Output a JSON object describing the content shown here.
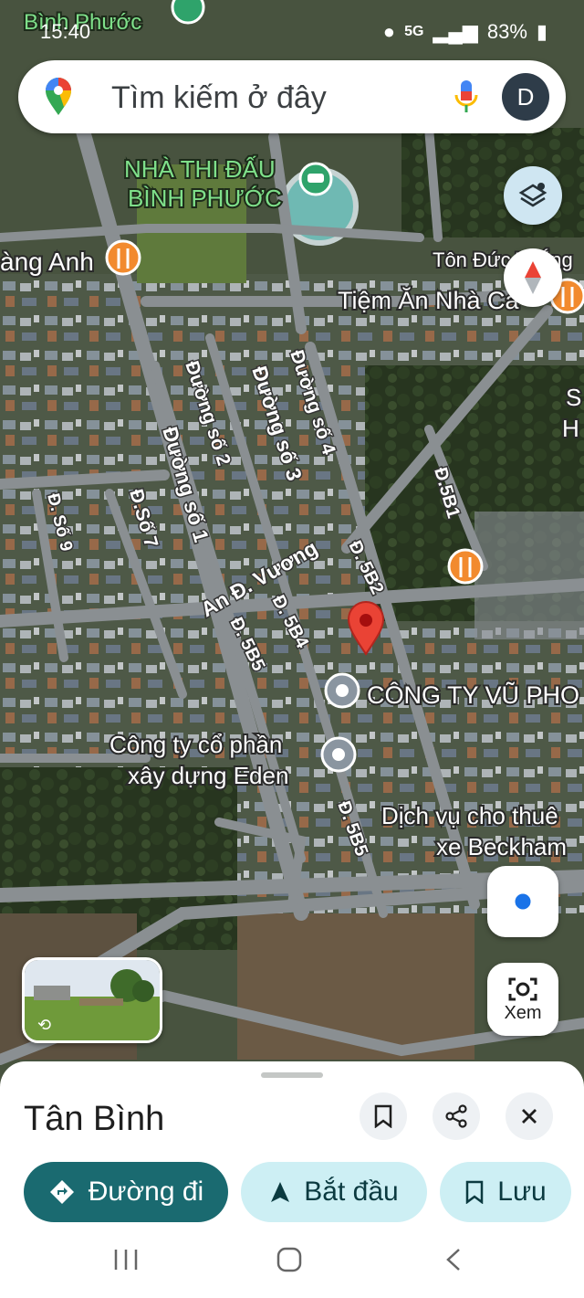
{
  "status": {
    "time": "15:40",
    "network": "5G",
    "battery": "83%"
  },
  "search": {
    "placeholder": "Tìm kiếm ở đây",
    "avatar_letter": "D"
  },
  "map": {
    "labels": {
      "top_cut": "Bình Phước",
      "stadium_line1": "NHÀ THI ĐẤU",
      "stadium_line2": "BÌNH PHƯỚC",
      "hoang_anh": "àng Anh",
      "ton_duc_thang": "Tôn Đức Thắng",
      "tiem_an": "Tiệm Ăn Nhà Cá",
      "right_s": "S",
      "right_h": "H",
      "duong_so_2": "Đường số 2",
      "duong_so_3": "Đường số 3",
      "duong_so_4": "Đường số 4",
      "duong_so_1": "Đường số 1",
      "d_so_7": "Đ.Số 7",
      "d_so_9": "Đ. Số 9",
      "d_5b1": "Đ.5B1",
      "d_5b2": "Đ. 5B2",
      "an_d_vuong": "An Đ. Vương",
      "d_5b4": "Đ. 5B4",
      "d_5b5": "Đ. 5B5",
      "d_5b5_lower": "Đ. 5B5",
      "cong_ty_vu": "CÔNG TY VŨ PHO",
      "eden_line1": "Công ty cổ phần",
      "eden_line2": "xây dựng Eden",
      "dich_vu_line1": "Dịch vụ cho thuê",
      "dich_vu_line2": "xe Beckham"
    },
    "explore_label": "Xem"
  },
  "place": {
    "title": "Tân Bình"
  },
  "actions": {
    "directions": "Đường đi",
    "start": "Bắt đầu",
    "save": "Lưu"
  },
  "colors": {
    "primary_button": "#1a6a70",
    "tonal_button": "#cdeff4",
    "pin_red": "#ea4335",
    "food_orange": "#f28a2e"
  }
}
